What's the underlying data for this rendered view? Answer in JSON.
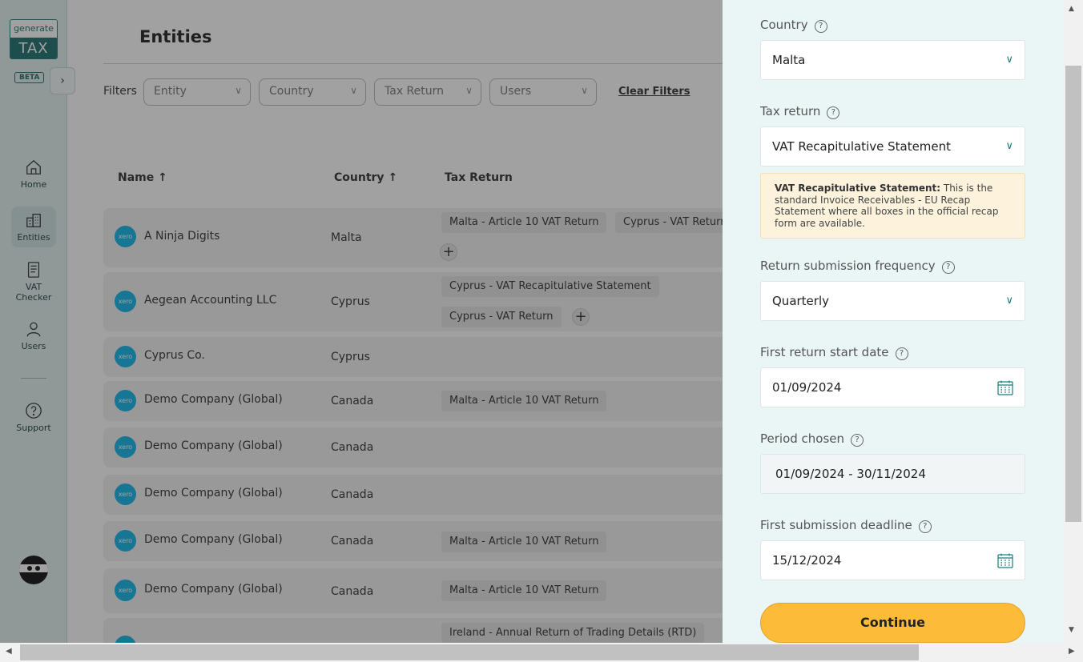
{
  "brand": {
    "logo_top": "generate",
    "logo_bottom": "TAX",
    "badge": "BETA"
  },
  "sidebar": {
    "items": [
      {
        "label": "Home"
      },
      {
        "label": "Entities"
      },
      {
        "label": "VAT Checker"
      },
      {
        "label": "Users"
      },
      {
        "label": "Support"
      }
    ]
  },
  "main": {
    "title": "Entities",
    "filters_label": "Filters",
    "filters": [
      "Entity",
      "Country",
      "Tax Return",
      "Users"
    ],
    "clear_filters": "Clear Filters",
    "columns": {
      "name": "Name",
      "country": "Country",
      "tax_return": "Tax Return"
    },
    "sort_arrow": "↑",
    "xero_label": "xero",
    "rows": [
      {
        "name": "A Ninja Digits",
        "country": "Malta",
        "chips": [
          "Malta - Article 10 VAT Return",
          "Cyprus - VAT Return"
        ]
      },
      {
        "name": "Aegean Accounting LLC",
        "country": "Cyprus",
        "chips": [
          "Cyprus - VAT Recapitulative Statement",
          "Cyprus - VAT Return"
        ]
      },
      {
        "name": "Cyprus Co.",
        "country": "Cyprus",
        "chips": []
      },
      {
        "name": "Demo Company (Global)",
        "country": "Canada",
        "chips": [
          "Malta - Article 10 VAT Return"
        ]
      },
      {
        "name": "Demo Company (Global)",
        "country": "Canada",
        "chips": []
      },
      {
        "name": "Demo Company (Global)",
        "country": "Canada",
        "chips": []
      },
      {
        "name": "Demo Company (Global)",
        "country": "Canada",
        "chips": [
          "Malta - Article 10 VAT Return"
        ]
      },
      {
        "name": "Demo Company (Global)",
        "country": "Canada",
        "chips": [
          "Malta - Article 10 VAT Return"
        ]
      },
      {
        "name": "",
        "country": "",
        "chips": [
          "Ireland - Annual Return of Trading Details (RTD)"
        ]
      }
    ]
  },
  "panel": {
    "country": {
      "label": "Country",
      "value": "Malta"
    },
    "tax_return": {
      "label": "Tax return",
      "value": "VAT Recapitulative Statement"
    },
    "info": {
      "title": "VAT Recapitulative Statement:",
      "text": "This is the standard Invoice Receivables - EU Recap Statement where all boxes in the official recap form are available."
    },
    "frequency": {
      "label": "Return submission frequency",
      "value": "Quarterly"
    },
    "start_date": {
      "label": "First return start date",
      "value": "01/09/2024"
    },
    "period": {
      "label": "Period chosen",
      "value": "01/09/2024 - 30/11/2024"
    },
    "deadline": {
      "label": "First submission deadline",
      "value": "15/12/2024"
    },
    "continue_label": "Continue",
    "help_glyph": "?"
  },
  "colors": {
    "accent": "#1e6f6f",
    "button": "#fdbb3a",
    "panel_bg": "#eaf5f5",
    "xero": "#13b5ea"
  }
}
